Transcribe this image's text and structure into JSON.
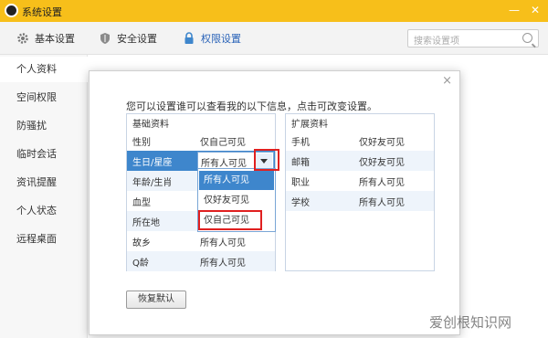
{
  "window": {
    "title": "系统设置",
    "minimize": "—",
    "close": "✕"
  },
  "toolbar": {
    "tabs": [
      {
        "label": "基本设置",
        "icon": "gear-icon"
      },
      {
        "label": "安全设置",
        "icon": "shield-icon"
      },
      {
        "label": "权限设置",
        "icon": "lock-icon",
        "active": true
      }
    ],
    "search_placeholder": "搜索设置项"
  },
  "sidebar": {
    "items": [
      {
        "label": "个人资料",
        "active": true
      },
      {
        "label": "空间权限"
      },
      {
        "label": "防骚扰"
      },
      {
        "label": "临时会话"
      },
      {
        "label": "资讯提醒"
      },
      {
        "label": "个人状态"
      },
      {
        "label": "远程桌面"
      }
    ]
  },
  "dialog": {
    "close": "×",
    "intro": "您可以设置谁可以查看我的以下信息，点击可改变设置。",
    "basic": {
      "title": "基础资料",
      "rows": [
        {
          "key": "性别",
          "value": "仅自己可见"
        },
        {
          "key": "生日/星座",
          "value": "所有人可见"
        },
        {
          "key": "年龄/生肖",
          "value": ""
        },
        {
          "key": "血型",
          "value": ""
        },
        {
          "key": "所在地",
          "value": ""
        },
        {
          "key": "故乡",
          "value": "所有人可见"
        },
        {
          "key": "Q龄",
          "value": "所有人可见"
        }
      ]
    },
    "extended": {
      "title": "扩展资料",
      "rows": [
        {
          "key": "手机",
          "value": "仅好友可见"
        },
        {
          "key": "邮箱",
          "value": "仅好友可见"
        },
        {
          "key": "职业",
          "value": "所有人可见"
        },
        {
          "key": "学校",
          "value": "所有人可见"
        }
      ]
    },
    "dropdown_options": [
      "所有人可见",
      "仅好友可见",
      "仅自己可见"
    ],
    "restore_button": "恢复默认"
  },
  "watermark": "爱创根知识网",
  "colors": {
    "titlebar": "#f7bf1a",
    "accent": "#3e86cc",
    "highlight": "#e02020"
  }
}
